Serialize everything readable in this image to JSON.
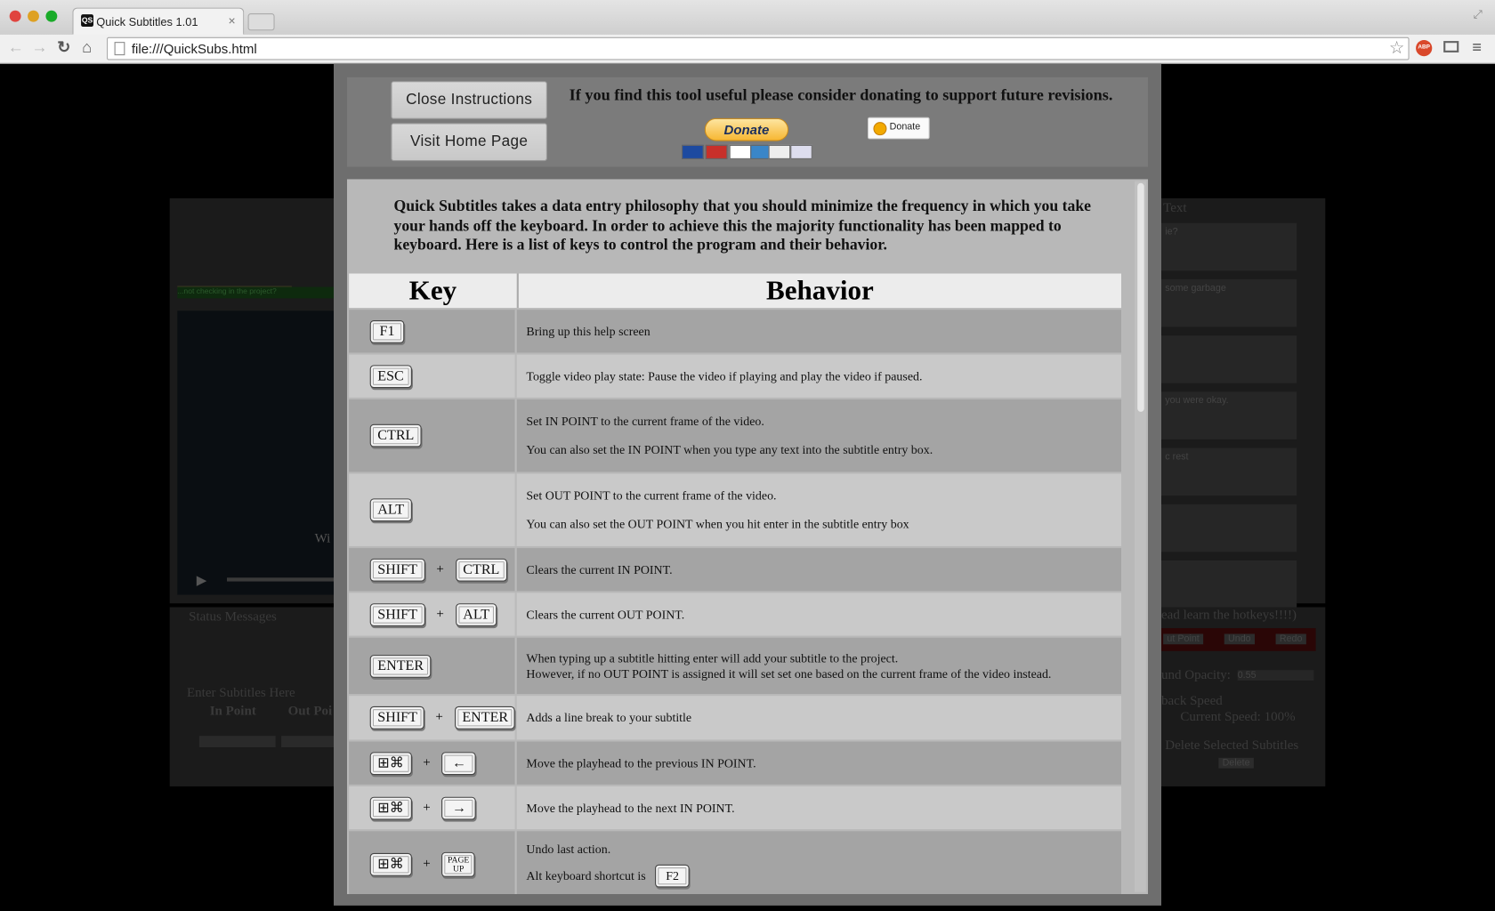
{
  "browser": {
    "tab_title": "Quick Subtitles 1.01",
    "tab_favicon": "QS",
    "url": "file:///QuickSubs.html",
    "extension_badge": "ABP"
  },
  "background_app": {
    "left_video_caption": "...not checking in the project?",
    "video_overlay": "Wi",
    "status_label": "Status Messages",
    "enter_label": "Enter Subtitles Here",
    "in_point_label": "In Point",
    "out_point_label": "Out Poi",
    "list_header": "Text",
    "list_items": [
      "ie?",
      "some garbage",
      "",
      "you were okay.",
      "c rest",
      "",
      ""
    ],
    "hotkey_hint": "ead learn the hotkeys!!!!)",
    "buttons": [
      "ut Point",
      "Undo",
      "Redo"
    ],
    "opacity_label": "und Opacity:",
    "opacity_value": "0.55",
    "speed_label": "back Speed",
    "current_speed": "Current Speed: 100%",
    "delete_label": "Delete Selected Subtitles",
    "delete_button": "Delete"
  },
  "modal": {
    "close_button": "Close Instructions",
    "home_button": "Visit Home Page",
    "donate_message": "If you find this tool useful please consider donating to support future revisions.",
    "paypal_donate": "Donate",
    "bitcoin_donate": "Donate",
    "intro": "Quick Subtitles takes a data entry philosophy that you should minimize the frequency in which you take your hands off the keyboard. In order to achieve this the majority functionality has been mapped to keyboard. Here is a list of keys to control the program and their behavior.",
    "table": {
      "headers": [
        "Key",
        "Behavior"
      ],
      "rows": [
        {
          "keys": [
            "F1"
          ],
          "behavior": [
            "Bring up this help screen"
          ]
        },
        {
          "keys": [
            "ESC"
          ],
          "behavior": [
            "Toggle video play state: Pause the video if playing and play the video if paused."
          ]
        },
        {
          "keys": [
            "CTRL"
          ],
          "behavior": [
            "Set IN POINT to the current frame of the video.",
            "You can also set the IN POINT when you type any text into the subtitle entry box."
          ]
        },
        {
          "keys": [
            "ALT"
          ],
          "behavior": [
            "Set OUT POINT to the current frame of the video.",
            "You can also set the OUT POINT when you hit enter in the subtitle entry box"
          ]
        },
        {
          "keys": [
            "SHIFT",
            "CTRL"
          ],
          "behavior": [
            "Clears the current IN POINT."
          ]
        },
        {
          "keys": [
            "SHIFT",
            "ALT"
          ],
          "behavior": [
            "Clears the current OUT POINT."
          ]
        },
        {
          "keys": [
            "ENTER"
          ],
          "behavior": [
            "When typing up a subtitle hitting enter will add your subtitle to the project.",
            "However, if no OUT POINT is assigned it will set set one based on the current frame of the video instead."
          ]
        },
        {
          "keys": [
            "SHIFT",
            "ENTER"
          ],
          "behavior": [
            "Adds a line break to your subtitle"
          ]
        },
        {
          "keys": [
            "⊞⌘",
            "←"
          ],
          "behavior": [
            "Move the playhead to the previous IN POINT."
          ]
        },
        {
          "keys": [
            "⊞⌘",
            "→"
          ],
          "behavior": [
            "Move the playhead to the next IN POINT."
          ]
        },
        {
          "keys": [
            "⊞⌘",
            "PAGE UP"
          ],
          "behavior": [
            "Undo last action.",
            "Alt keyboard shortcut is"
          ],
          "alt_key": "F2"
        }
      ]
    }
  }
}
